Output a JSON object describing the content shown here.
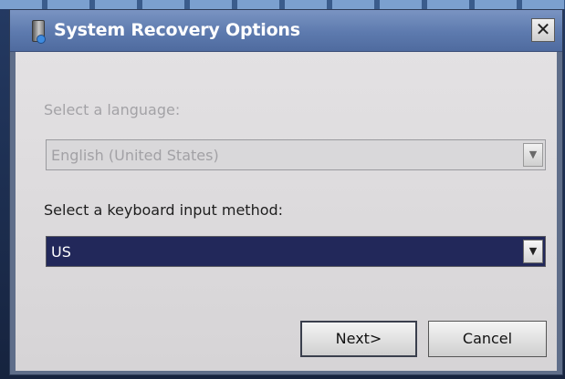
{
  "window": {
    "title": "System Recovery Options",
    "close_glyph": "✕",
    "icon": "system-recovery-icon"
  },
  "language": {
    "label": "Select a language:",
    "value": "English (United States)",
    "enabled": false
  },
  "keyboard": {
    "label": "Select a keyboard input method:",
    "value": "US",
    "enabled": true,
    "selected": true
  },
  "buttons": {
    "next_label": "Next>",
    "cancel_label": "Cancel"
  },
  "dropdown_glyph": "▼",
  "colors": {
    "titlebar": "#5d7aae",
    "dialog_body": "#dedcde",
    "selection": "#22285a",
    "disabled_text": "#a3a2a6"
  }
}
